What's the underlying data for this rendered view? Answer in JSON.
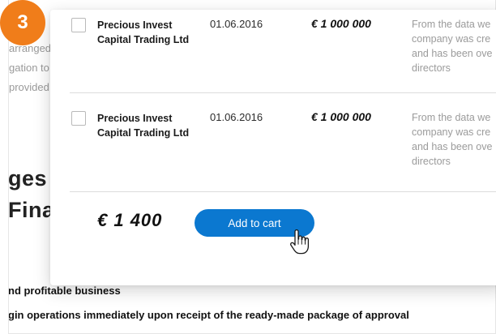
{
  "step": {
    "number": "3"
  },
  "background": {
    "fragments": [
      "arranged",
      "gation to",
      "provided"
    ],
    "heading_lines": [
      "ges",
      "Fina"
    ],
    "bold_lines": [
      "nd profitable business",
      "gin operations immediately upon receipt of the ready-made package of approval"
    ]
  },
  "offers": [
    {
      "company": "Precious Invest Capital Trading Ltd",
      "date": "01.06.2016",
      "price": "€ 1 000 000",
      "description_lines": [
        "From the data we",
        "company was cre",
        "and has been ove",
        "directors"
      ]
    },
    {
      "company": "Precious Invest Capital Trading Ltd",
      "date": "01.06.2016",
      "price": "€ 1 000 000",
      "description_lines": [
        "From the data we",
        "company was cre",
        "and has been ove",
        "directors"
      ]
    }
  ],
  "summary": {
    "total": "€ 1 400",
    "add_to_cart_label": "Add to cart"
  },
  "colors": {
    "badge": "#f07d1a",
    "button": "#0b78d0"
  },
  "icons": {
    "cursor": "hand-pointer-icon"
  }
}
